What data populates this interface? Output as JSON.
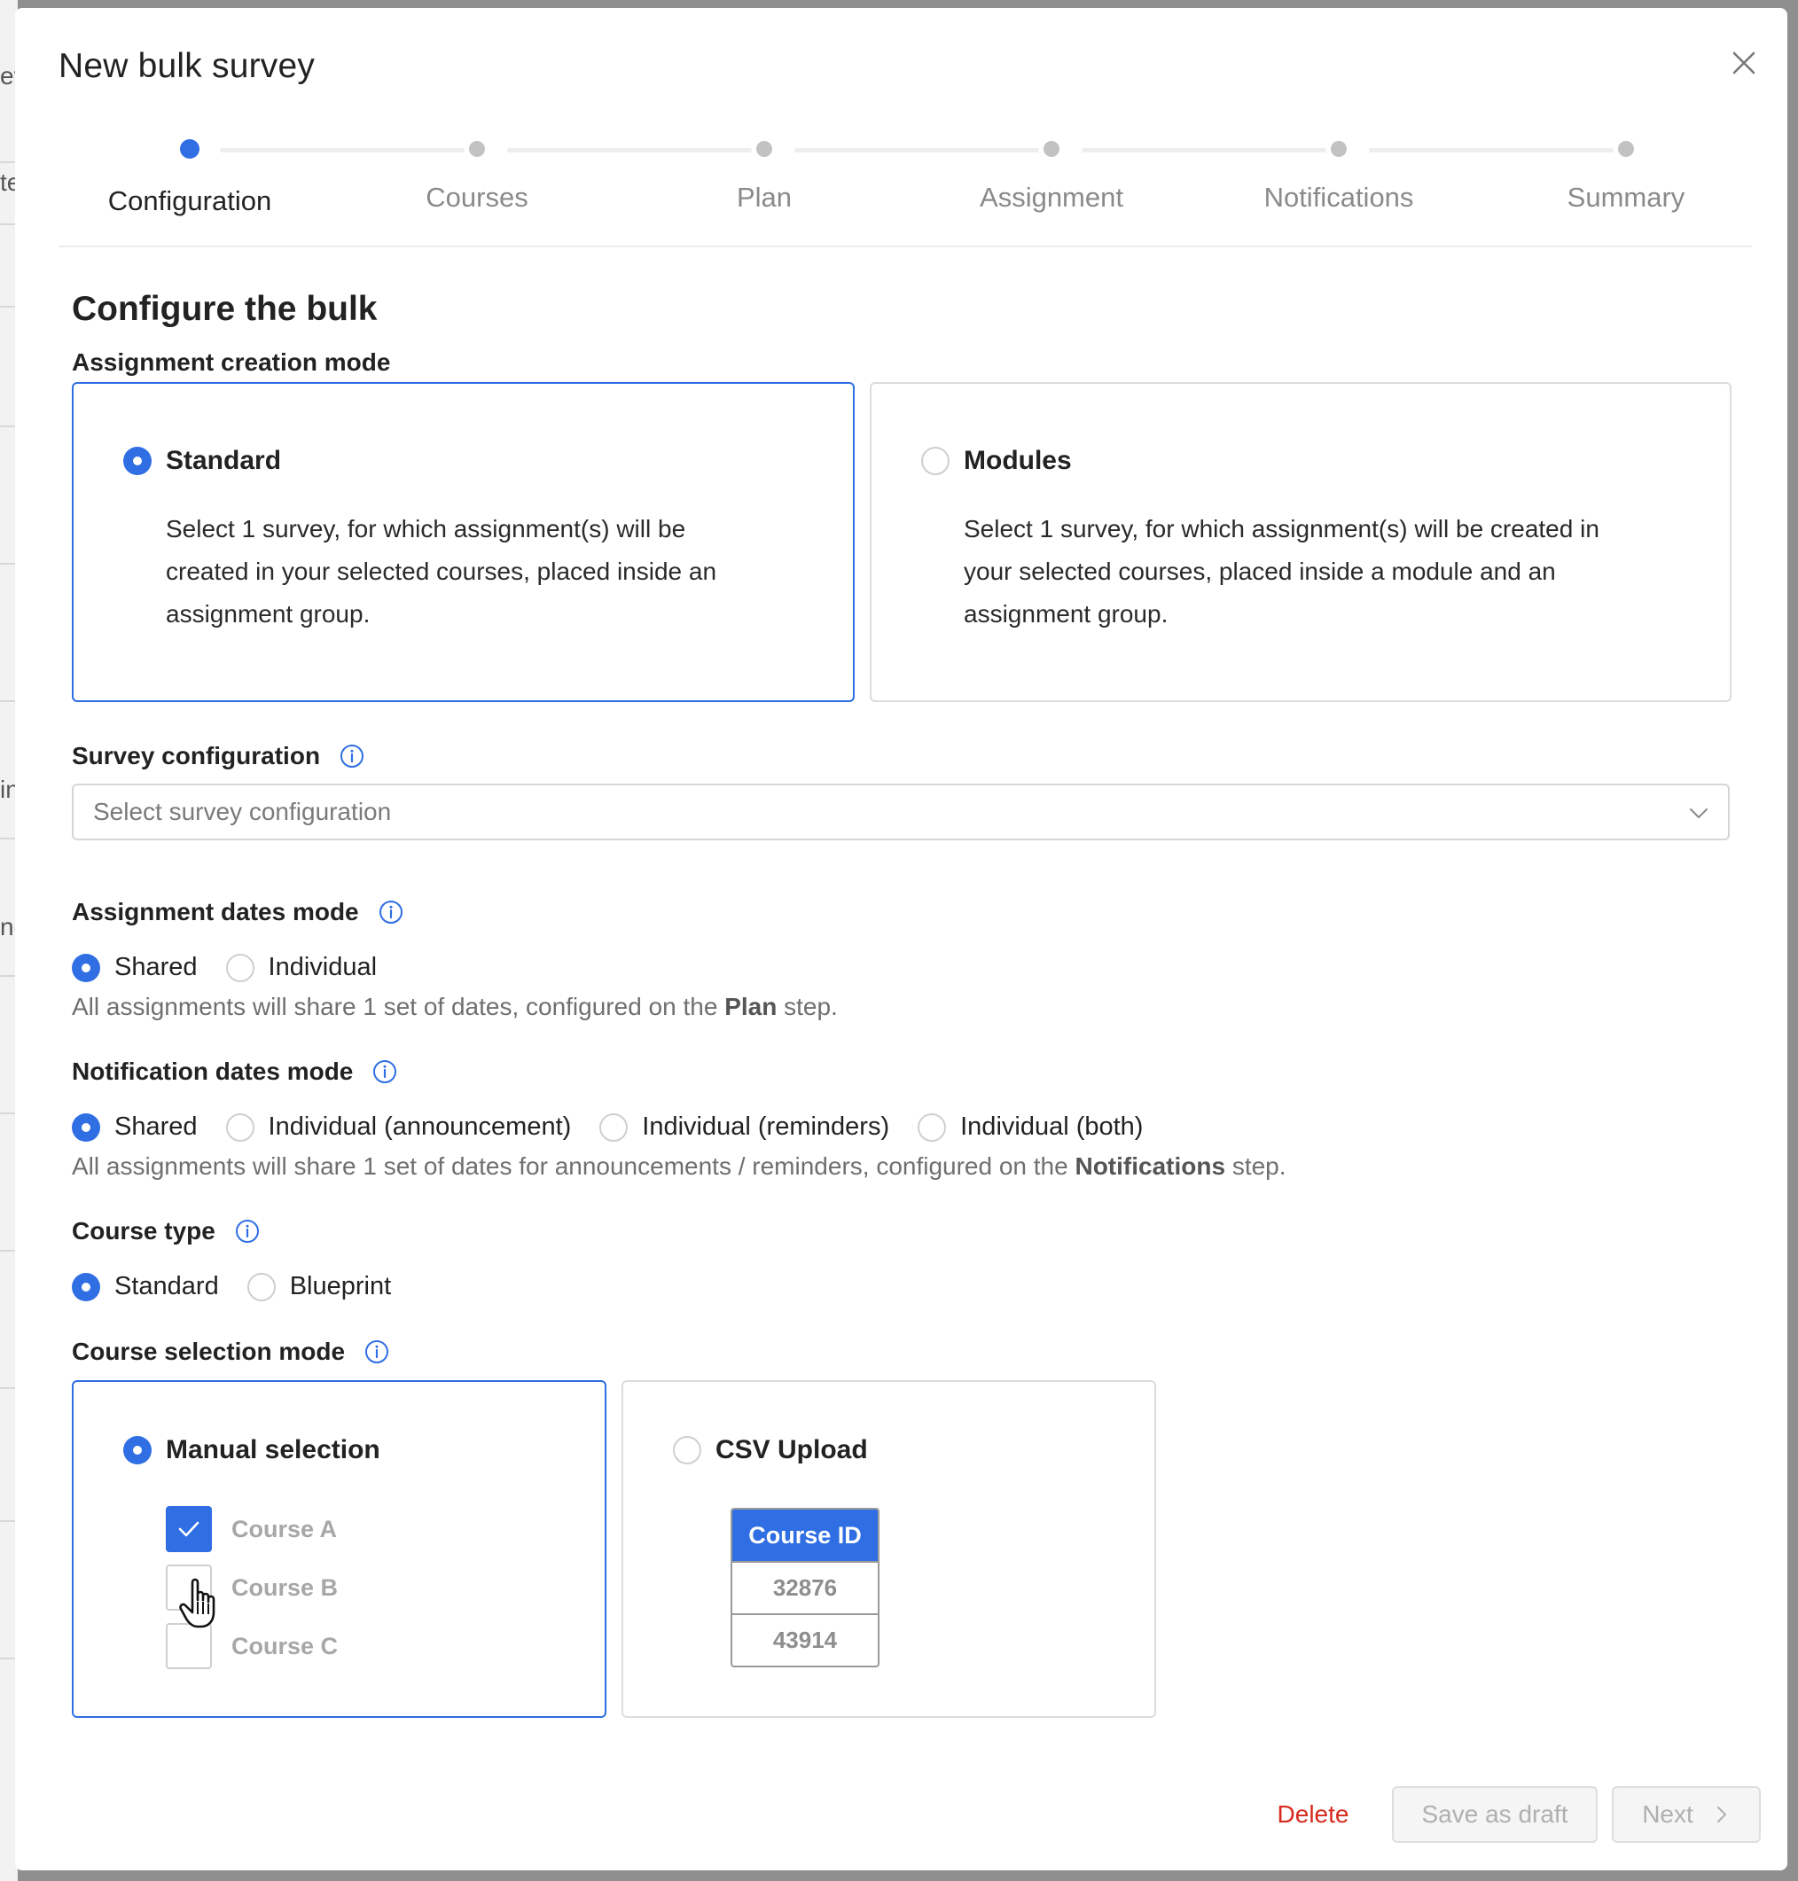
{
  "background_fragments": [
    "ev",
    "te",
    "in",
    "nc"
  ],
  "modal": {
    "title": "New bulk survey",
    "close_label": "Close"
  },
  "stepper": {
    "steps": [
      {
        "label": "Configuration",
        "active": true
      },
      {
        "label": "Courses",
        "active": false
      },
      {
        "label": "Plan",
        "active": false
      },
      {
        "label": "Assignment",
        "active": false
      },
      {
        "label": "Notifications",
        "active": false
      },
      {
        "label": "Summary",
        "active": false
      }
    ]
  },
  "section_title": "Configure the bulk",
  "assignment_creation_mode": {
    "label": "Assignment creation mode",
    "options": [
      {
        "title": "Standard",
        "selected": true,
        "description": "Select 1 survey, for which assignment(s) will be created in your selected courses, placed inside an assignment group."
      },
      {
        "title": "Modules",
        "selected": false,
        "description": "Select 1 survey, for which assignment(s) will be created in your selected courses, placed inside a module and an assignment group."
      }
    ]
  },
  "survey_configuration": {
    "label": "Survey configuration",
    "placeholder": "Select survey configuration"
  },
  "assignment_dates_mode": {
    "label": "Assignment dates mode",
    "options": [
      {
        "label": "Shared",
        "selected": true
      },
      {
        "label": "Individual",
        "selected": false
      }
    ],
    "help_prefix": "All assignments will share 1 set of dates, configured on the ",
    "help_bold": "Plan",
    "help_suffix": " step."
  },
  "notification_dates_mode": {
    "label": "Notification dates mode",
    "options": [
      {
        "label": "Shared",
        "selected": true
      },
      {
        "label": "Individual (announcement)",
        "selected": false
      },
      {
        "label": "Individual (reminders)",
        "selected": false
      },
      {
        "label": "Individual (both)",
        "selected": false
      }
    ],
    "help_prefix": "All assignments will share 1 set of dates for announcements / reminders, configured on the ",
    "help_bold": "Notifications",
    "help_suffix": " step."
  },
  "course_type": {
    "label": "Course type",
    "options": [
      {
        "label": "Standard",
        "selected": true
      },
      {
        "label": "Blueprint",
        "selected": false
      }
    ]
  },
  "course_selection_mode": {
    "label": "Course selection mode",
    "manual": {
      "title": "Manual selection",
      "selected": true,
      "courses": [
        {
          "label": "Course A",
          "checked": true
        },
        {
          "label": "Course B",
          "checked": false
        },
        {
          "label": "Course C",
          "checked": false
        }
      ]
    },
    "csv": {
      "title": "CSV Upload",
      "selected": false,
      "table_header": "Course ID",
      "rows": [
        "32876",
        "43914"
      ]
    }
  },
  "footer": {
    "delete_label": "Delete",
    "save_draft_label": "Save as draft",
    "next_label": "Next"
  },
  "colors": {
    "accent": "#2f6ee3",
    "danger": "#d62a1e",
    "overlay": "#8f8f8f"
  }
}
